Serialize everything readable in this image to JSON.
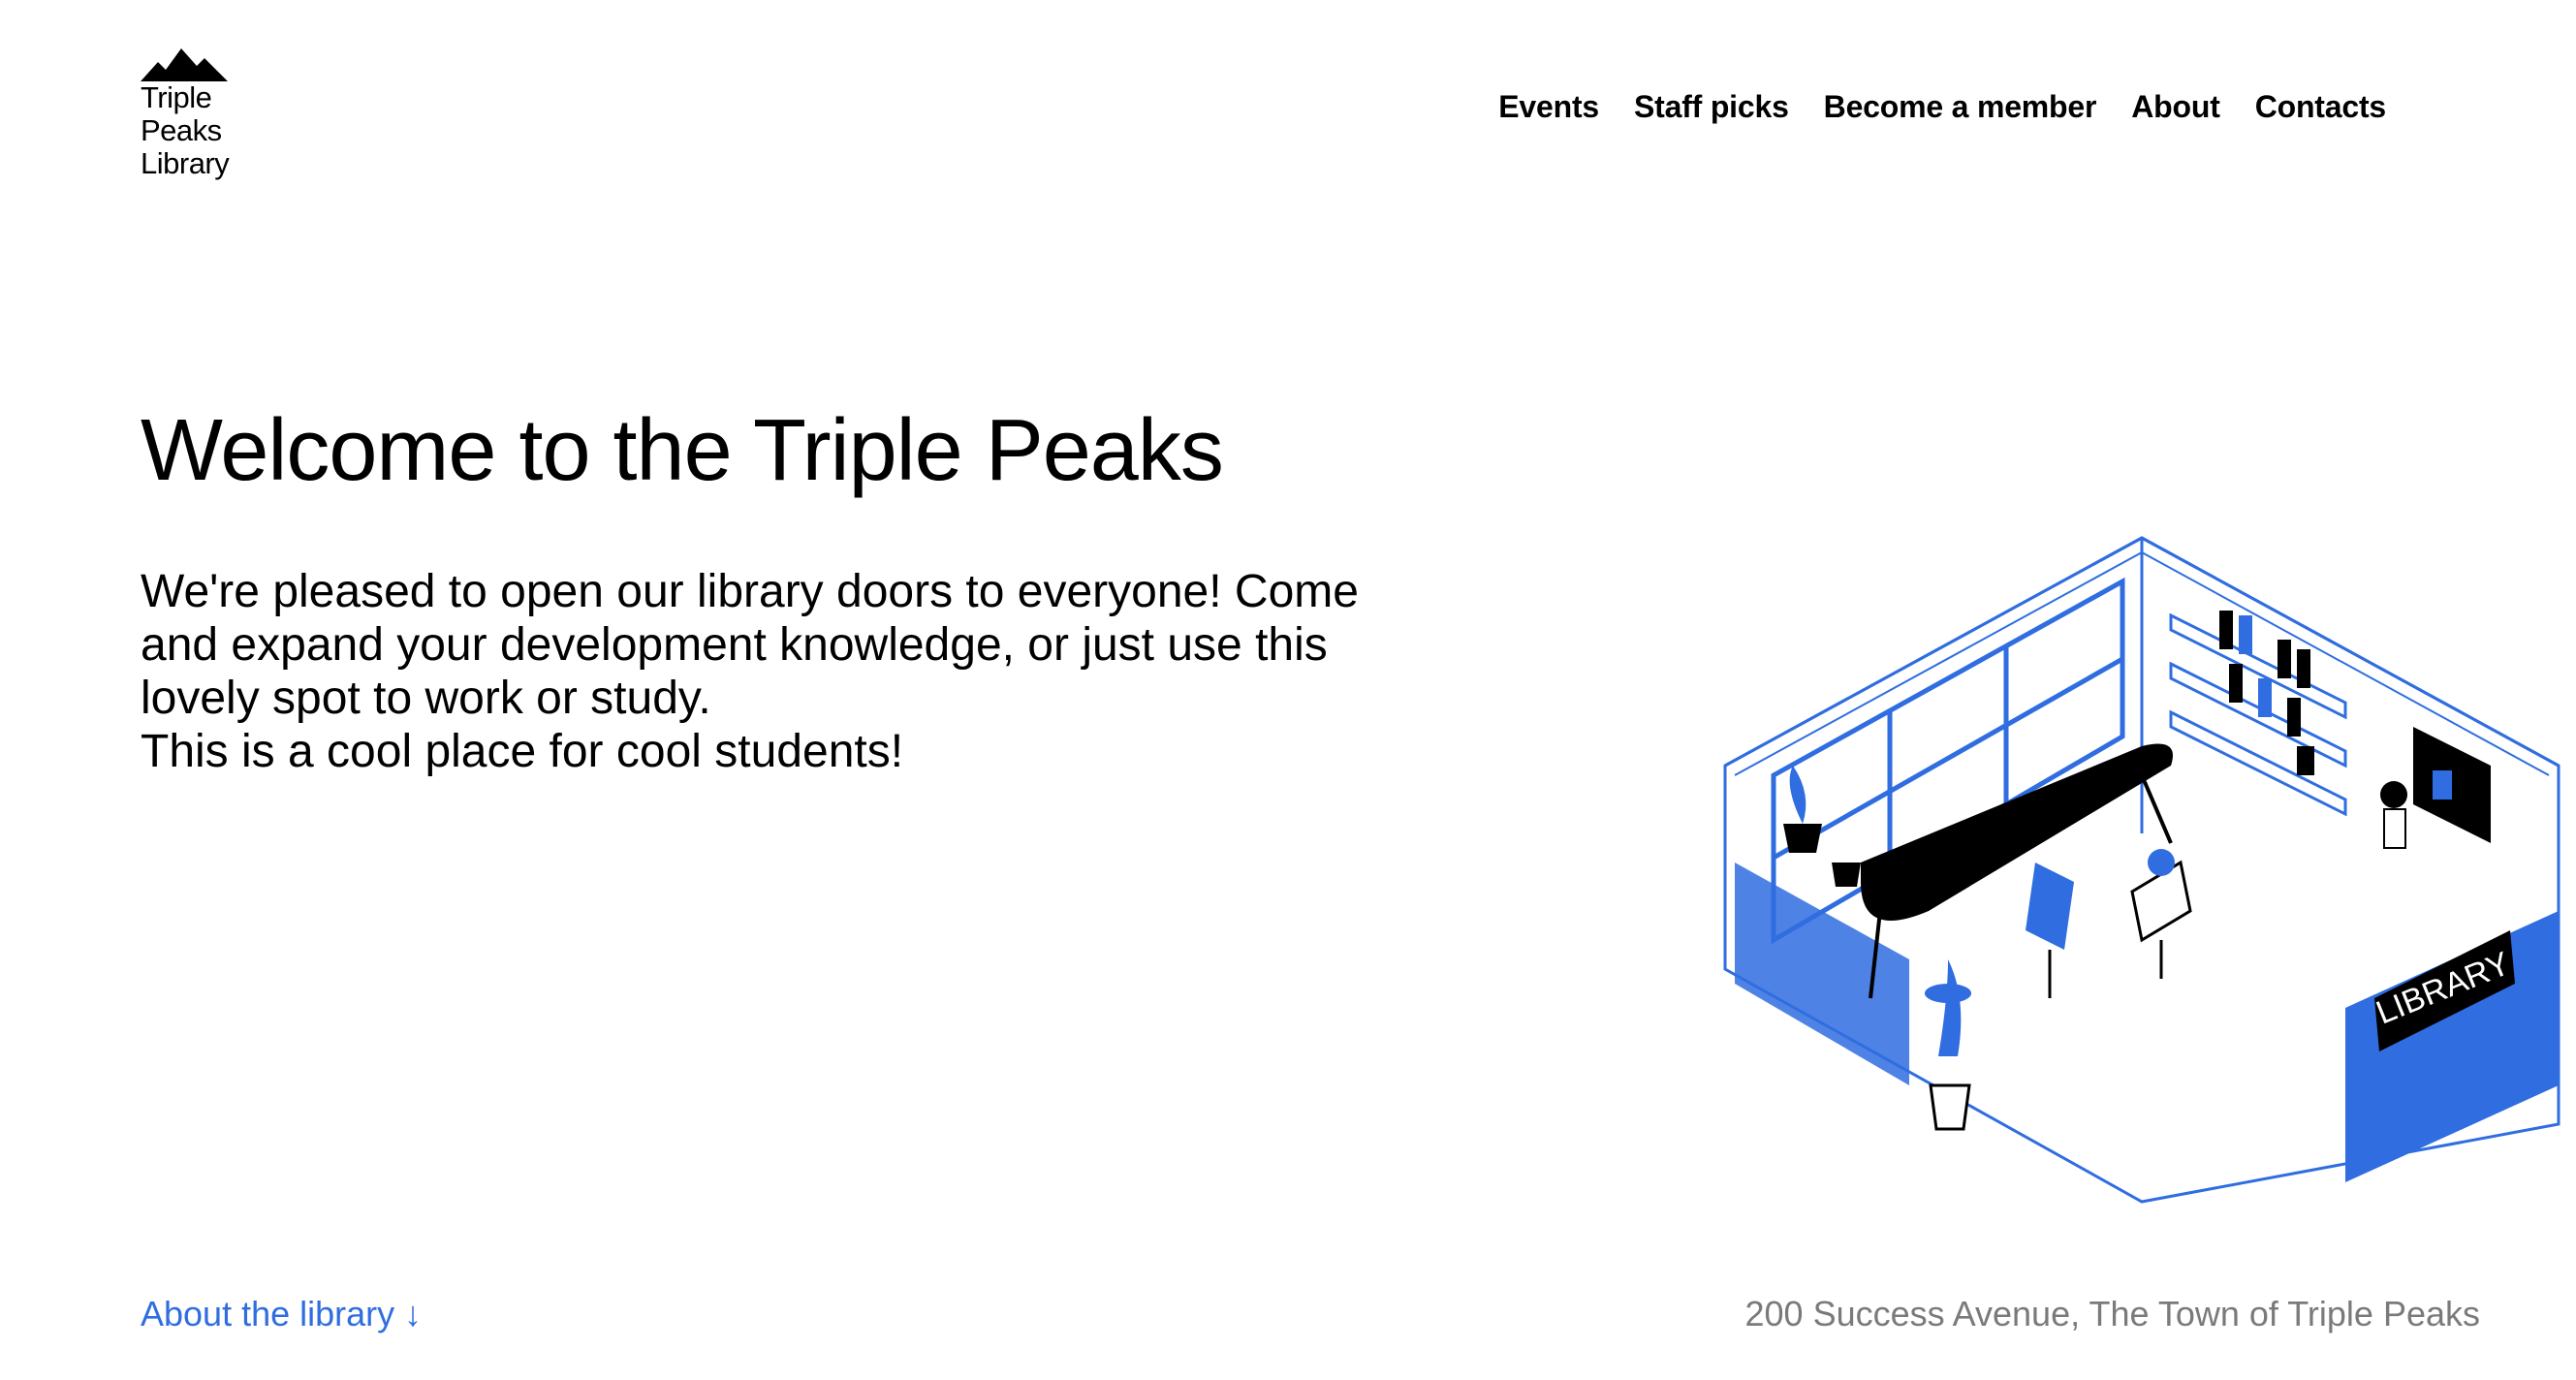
{
  "brand": {
    "name_lines": [
      "Triple",
      "Peaks",
      "Library"
    ],
    "accent_color": "#2f6de0",
    "logo_icon": "mountain-peaks-icon"
  },
  "nav": {
    "items": [
      {
        "label": "Events"
      },
      {
        "label": "Staff picks"
      },
      {
        "label": "Become a member"
      },
      {
        "label": "About"
      },
      {
        "label": "Contacts"
      }
    ]
  },
  "hero": {
    "title": "Welcome to the Triple Peaks",
    "description_lines": [
      "We're pleased to open our library doors to everyone! Come",
      "and expand your development knowledge, or just use this",
      "lovely spot to work or study.",
      "This is a cool place for cool students!"
    ],
    "illustration_sign": "LIBRARY"
  },
  "footer": {
    "about_link": "About the library ↓",
    "address": "200 Success Avenue, The Town of Triple Peaks"
  }
}
